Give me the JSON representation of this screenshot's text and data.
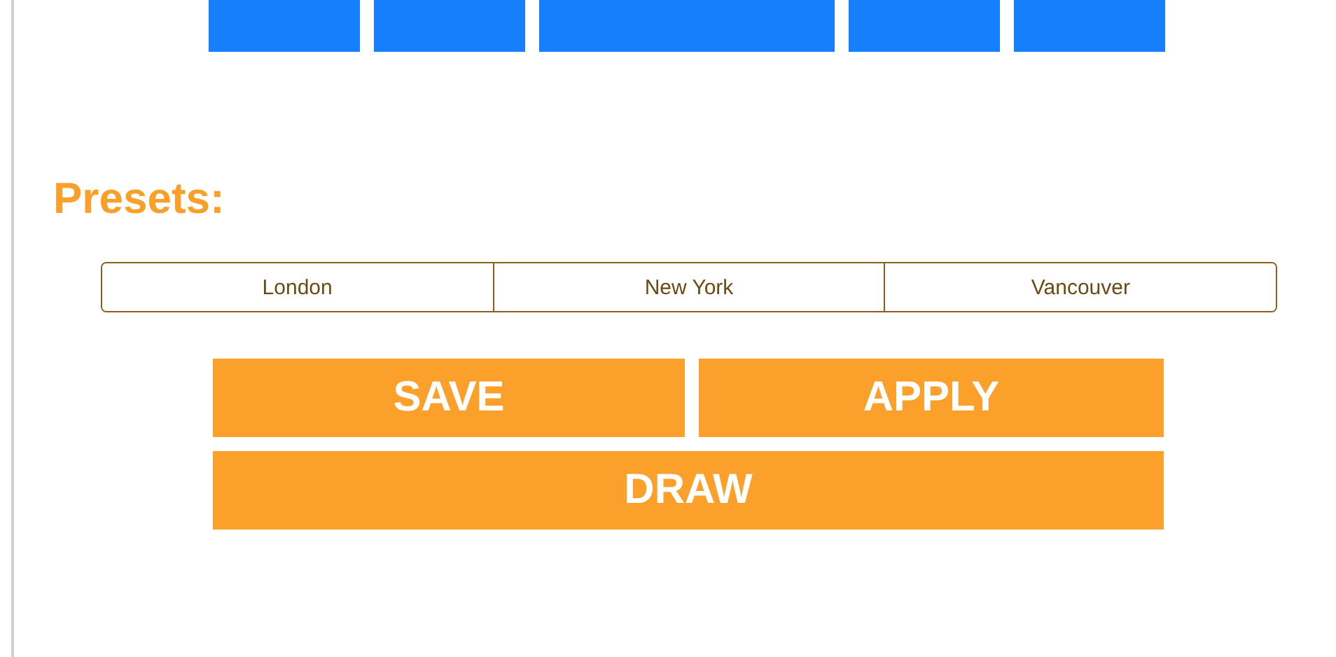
{
  "nav_buttons": [
    {
      "kind": "narrow"
    },
    {
      "kind": "narrow"
    },
    {
      "kind": "wide"
    },
    {
      "kind": "narrow"
    },
    {
      "kind": "narrow"
    }
  ],
  "presets": {
    "title": "Presets:",
    "segments": [
      {
        "label": "London",
        "selected": false
      },
      {
        "label": "New York",
        "selected": false
      },
      {
        "label": "Vancouver",
        "selected": false
      }
    ]
  },
  "actions": {
    "save": "SAVE",
    "apply": "APPLY",
    "draw": "DRAW"
  }
}
